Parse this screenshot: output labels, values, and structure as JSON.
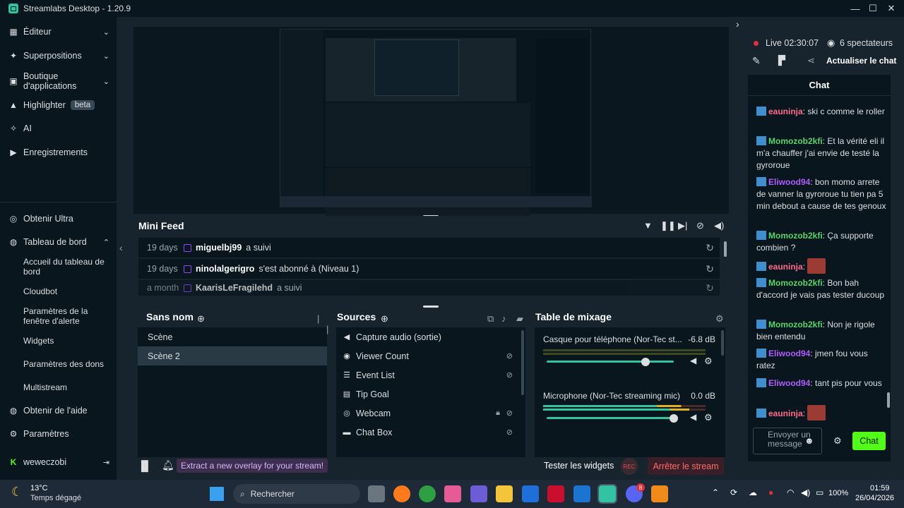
{
  "window": {
    "title": "Streamlabs Desktop - 1.20.9"
  },
  "sidebar": {
    "items": [
      {
        "label": "Éditeur",
        "icon": "editor-icon"
      },
      {
        "label": "Superpositions",
        "icon": "overlays-icon"
      },
      {
        "label": "Boutique d'applications",
        "icon": "app-store-icon"
      },
      {
        "label": "Highlighter",
        "badge": "beta",
        "icon": "highlighter-icon"
      },
      {
        "label": "AI",
        "icon": "ai-icon"
      },
      {
        "label": "Enregistrements",
        "icon": "recordings-icon"
      },
      {
        "label": "Obtenir Ultra",
        "icon": "ultra-icon"
      },
      {
        "label": "Tableau de bord",
        "icon": "dashboard-icon"
      },
      {
        "label": "Obtenir de l'aide",
        "icon": "help-icon"
      },
      {
        "label": "Paramètres",
        "icon": "settings-icon"
      }
    ],
    "dashboard_sub": [
      "Accueil du tableau de bord",
      "Cloudbot",
      "Paramètres de la fenêtre d'alerte",
      "Widgets",
      "Paramètres des dons",
      "Multistream"
    ],
    "user": "weweczobi"
  },
  "minifeed": {
    "title": "Mini Feed",
    "events": [
      {
        "date": "19 days",
        "user": "miguelbj99",
        "action": "a suivi"
      },
      {
        "date": "19 days",
        "user": "ninolalgerigro",
        "action": "s'est abonné à (Niveau 1)"
      },
      {
        "date": "a month",
        "user": "KaarisLeFragilehd",
        "action": "a suivi"
      }
    ]
  },
  "scenes": {
    "title": "Sans nom",
    "items": [
      "Scène",
      "Scène 2"
    ],
    "selected": 1
  },
  "sources": {
    "title": "Sources",
    "items": [
      {
        "label": "Capture audio (sortie)",
        "icon": "speaker-icon"
      },
      {
        "label": "Viewer Count",
        "icon": "eye-icon"
      },
      {
        "label": "Event List",
        "icon": "list-icon"
      },
      {
        "label": "Tip Goal",
        "icon": "calendar-icon"
      },
      {
        "label": "Webcam",
        "icon": "webcam-icon"
      },
      {
        "label": "Chat Box",
        "icon": "chat-icon"
      }
    ]
  },
  "mixer": {
    "title": "Table de mixage",
    "channels": [
      {
        "name": "Casque pour téléphone (Nor-Tec st...",
        "db": "-6.8 dB",
        "level": 0.78
      },
      {
        "name": "Microphone (Nor-Tec streaming mic)",
        "db": "0.0 dB",
        "level": 1.0
      }
    ]
  },
  "footer": {
    "extract": "Extract a new overlay for your stream!",
    "test_widgets": "Tester les widgets",
    "rec": "REC",
    "stop": "Arrêter le stream"
  },
  "live": {
    "status": "Live 02:30:07",
    "viewers": "6 spectateurs",
    "refresh": "Actualiser le chat"
  },
  "chat": {
    "title": "Chat",
    "input_placeholder": "Envoyer un message",
    "send": "Chat",
    "messages": [
      {
        "user": "eauninja",
        "color": "#ff6b8a",
        "text": ": ski c comme le roller"
      },
      {
        "user": "Momozob2kfi",
        "color": "#5bd46a",
        "text": ": Et la vérité eli il m'a chauffer j'ai envie de testé la gyroroue"
      },
      {
        "user": "Eliwood94",
        "color": "#b05cff",
        "text": ": bon momo arrete de vanner la gyroroue tu tien pa 5 min debout a cause de tes genoux"
      },
      {
        "user": "Momozob2kfi",
        "color": "#5bd46a",
        "text": ": Ça supporte combien ?"
      },
      {
        "user": "eauninja",
        "color": "#ff6b8a",
        "text": ":"
      },
      {
        "user": "Momozob2kfi",
        "color": "#5bd46a",
        "text": ": Bon bah d'accord je vais pas tester ducoup"
      },
      {
        "user": "Momozob2kfi",
        "color": "#5bd46a",
        "text": ": Non je rigole bien entendu"
      },
      {
        "user": "Eliwood94",
        "color": "#b05cff",
        "text": ": jmen fou vous ratez"
      },
      {
        "user": "Eliwood94",
        "color": "#b05cff",
        "text": ": tant pis pour vous"
      },
      {
        "user": "eauninja",
        "color": "#ff6b8a",
        "text": ":"
      }
    ]
  },
  "taskbar": {
    "weather_temp": "13°C",
    "weather_desc": "Temps dégagé",
    "search": "Rechercher",
    "battery": "100%",
    "time": "01:59",
    "date": "26/04/2026",
    "discord_badge": "8"
  }
}
